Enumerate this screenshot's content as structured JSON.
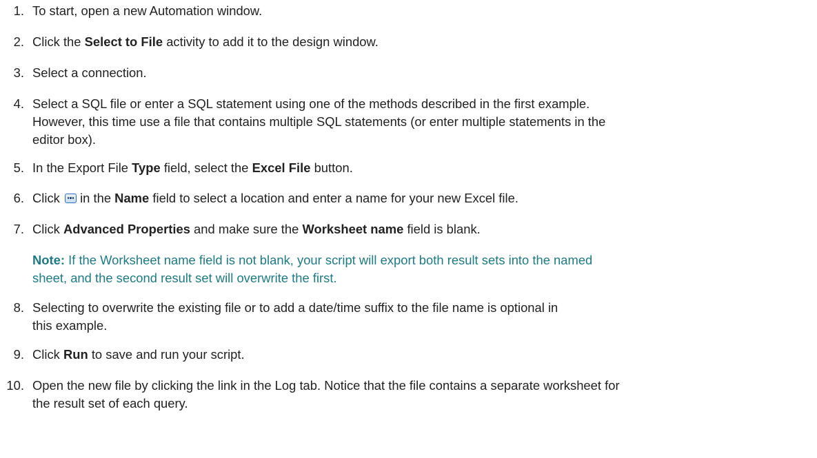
{
  "steps": [
    {
      "num": "1.",
      "text": "To start, open a new Automation window."
    },
    {
      "num": "2.",
      "pre": "Click the ",
      "bold": "Select to File",
      "post": " activity to add it to the design window."
    },
    {
      "num": "3.",
      "text": "Select a connection."
    },
    {
      "num": "4.",
      "line1": "Select a SQL file or enter a SQL statement using one of the methods described in the first example.",
      "line2": "However, this time use a file that contains multiple SQL statements (or enter multiple statements in the",
      "line3": "editor box)."
    },
    {
      "num": "5.",
      "pre": "In the Export File ",
      "bold1": "Type",
      "mid": " field, select the ",
      "bold2": "Excel File",
      "post": " button."
    },
    {
      "num": "6.",
      "pre": "Click ",
      "icon": "ellipsis-button-icon",
      "mid": " in the ",
      "bold": "Name",
      "post": " field to select a location and enter a name for your new Excel file."
    },
    {
      "num": "7.",
      "pre": "Click ",
      "bold1": "Advanced Properties",
      "mid": " and make sure the ",
      "bold2": "Worksheet name",
      "post": " field is blank."
    },
    {
      "num": "8.",
      "line1": "Selecting to overwrite the existing file or to add a date/time suffix to the file name is optional in",
      "line2": "this example."
    },
    {
      "num": "9.",
      "pre": "Click ",
      "bold": "Run",
      "post": " to save and run your script."
    },
    {
      "num": "10.",
      "line1": "Open the new file by clicking the link in the Log tab. Notice that the file contains a separate worksheet for",
      "line2": "the result set of each query."
    }
  ],
  "note": {
    "label": "Note:",
    "line1": " If the Worksheet name field is not blank, your script will export both result sets into the named",
    "line2": "sheet, and the second result set will overwrite the first."
  },
  "colors": {
    "text": "#222222",
    "note": "#1f7a82",
    "icon_border": "#2f6fbf"
  }
}
